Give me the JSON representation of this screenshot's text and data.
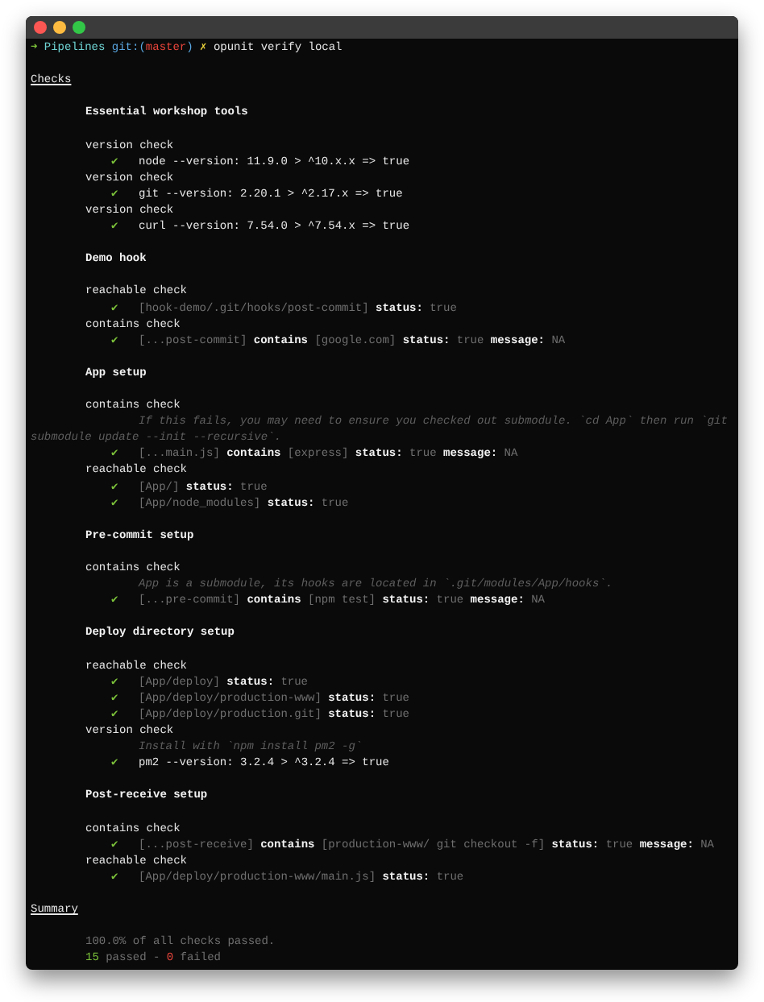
{
  "window": {
    "controls": [
      {
        "color": "#fc5753"
      },
      {
        "color": "#fdbc40"
      },
      {
        "color": "#33c748"
      }
    ]
  },
  "prompt": {
    "arrow": "➜",
    "directory": "Pipelines",
    "branch_open": "git:(",
    "branch": "master",
    "branch_close": ")",
    "dirty_mark": "✗",
    "command": "opunit verify local"
  },
  "checks_heading": "Checks",
  "sections": [
    {
      "title": "Essential workshop tools",
      "checks": [
        {
          "label": "version check",
          "items": [
            {
              "kind": "result",
              "passed": true,
              "mark": "✔",
              "segments": [
                {
                  "text": "node --version: 11.9.0 > ^10.x.x => true",
                  "kind": "plain"
                }
              ]
            }
          ]
        },
        {
          "label": "version check",
          "items": [
            {
              "kind": "result",
              "passed": true,
              "mark": "✔",
              "segments": [
                {
                  "text": "git --version: 2.20.1 > ^2.17.x => true",
                  "kind": "plain"
                }
              ]
            }
          ]
        },
        {
          "label": "version check",
          "items": [
            {
              "kind": "result",
              "passed": true,
              "mark": "✔",
              "segments": [
                {
                  "text": "curl --version: 7.54.0 > ^7.54.x => true",
                  "kind": "plain"
                }
              ]
            }
          ]
        }
      ]
    },
    {
      "title": "Demo hook",
      "checks": [
        {
          "label": "reachable check",
          "items": [
            {
              "kind": "result",
              "passed": true,
              "mark": "✔",
              "segments": [
                {
                  "text": "[hook-demo/.git/hooks/post-commit]",
                  "kind": "dim"
                },
                {
                  "text": "status:",
                  "kind": "bold"
                },
                {
                  "text": "true",
                  "kind": "dim"
                }
              ]
            }
          ]
        },
        {
          "label": "contains check",
          "items": [
            {
              "kind": "result",
              "passed": true,
              "mark": "✔",
              "segments": [
                {
                  "text": "[...post-commit]",
                  "kind": "dim"
                },
                {
                  "text": "contains",
                  "kind": "bold"
                },
                {
                  "text": "[google.com]",
                  "kind": "dim"
                },
                {
                  "text": "status:",
                  "kind": "bold"
                },
                {
                  "text": "true",
                  "kind": "dim"
                },
                {
                  "text": "message:",
                  "kind": "bold"
                },
                {
                  "text": "NA",
                  "kind": "dim"
                }
              ]
            }
          ]
        }
      ]
    },
    {
      "title": "App setup",
      "checks": [
        {
          "label": "contains check",
          "items": [
            {
              "kind": "note",
              "lines": [
                "If this fails, you may need to ensure you checked out submodule. `cd App` then run `git",
                "submodule update --init --recursive`."
              ]
            },
            {
              "kind": "result",
              "passed": true,
              "mark": "✔",
              "segments": [
                {
                  "text": "[...main.js]",
                  "kind": "dim"
                },
                {
                  "text": "contains",
                  "kind": "bold"
                },
                {
                  "text": "[express]",
                  "kind": "dim"
                },
                {
                  "text": "status:",
                  "kind": "bold"
                },
                {
                  "text": "true",
                  "kind": "dim"
                },
                {
                  "text": "message:",
                  "kind": "bold"
                },
                {
                  "text": "NA",
                  "kind": "dim"
                }
              ]
            }
          ]
        },
        {
          "label": "reachable check",
          "items": [
            {
              "kind": "result",
              "passed": true,
              "mark": "✔",
              "segments": [
                {
                  "text": "[App/]",
                  "kind": "dim"
                },
                {
                  "text": "status:",
                  "kind": "bold"
                },
                {
                  "text": "true",
                  "kind": "dim"
                }
              ]
            },
            {
              "kind": "result",
              "passed": true,
              "mark": "✔",
              "segments": [
                {
                  "text": "[App/node_modules]",
                  "kind": "dim"
                },
                {
                  "text": "status:",
                  "kind": "bold"
                },
                {
                  "text": "true",
                  "kind": "dim"
                }
              ]
            }
          ]
        }
      ]
    },
    {
      "title": "Pre-commit setup",
      "checks": [
        {
          "label": "contains check",
          "items": [
            {
              "kind": "note",
              "lines": [
                "App is a submodule, its hooks are located in `.git/modules/App/hooks`."
              ]
            },
            {
              "kind": "result",
              "passed": true,
              "mark": "✔",
              "segments": [
                {
                  "text": "[...pre-commit]",
                  "kind": "dim"
                },
                {
                  "text": "contains",
                  "kind": "bold"
                },
                {
                  "text": "[npm test]",
                  "kind": "dim"
                },
                {
                  "text": "status:",
                  "kind": "bold"
                },
                {
                  "text": "true",
                  "kind": "dim"
                },
                {
                  "text": "message:",
                  "kind": "bold"
                },
                {
                  "text": "NA",
                  "kind": "dim"
                }
              ]
            }
          ]
        }
      ]
    },
    {
      "title": "Deploy directory setup",
      "checks": [
        {
          "label": "reachable check",
          "items": [
            {
              "kind": "result",
              "passed": true,
              "mark": "✔",
              "segments": [
                {
                  "text": "[App/deploy]",
                  "kind": "dim"
                },
                {
                  "text": "status:",
                  "kind": "bold"
                },
                {
                  "text": "true",
                  "kind": "dim"
                }
              ]
            },
            {
              "kind": "result",
              "passed": true,
              "mark": "✔",
              "segments": [
                {
                  "text": "[App/deploy/production-www]",
                  "kind": "dim"
                },
                {
                  "text": "status:",
                  "kind": "bold"
                },
                {
                  "text": "true",
                  "kind": "dim"
                }
              ]
            },
            {
              "kind": "result",
              "passed": true,
              "mark": "✔",
              "segments": [
                {
                  "text": "[App/deploy/production.git]",
                  "kind": "dim"
                },
                {
                  "text": "status:",
                  "kind": "bold"
                },
                {
                  "text": "true",
                  "kind": "dim"
                }
              ]
            }
          ]
        },
        {
          "label": "version check",
          "items": [
            {
              "kind": "note",
              "lines": [
                "Install with `npm install pm2 -g`"
              ]
            },
            {
              "kind": "result",
              "passed": true,
              "mark": "✔",
              "segments": [
                {
                  "text": "pm2 --version: 3.2.4 > ^3.2.4 => true",
                  "kind": "plain"
                }
              ]
            }
          ]
        }
      ]
    },
    {
      "title": "Post-receive setup",
      "checks": [
        {
          "label": "contains check",
          "items": [
            {
              "kind": "result",
              "passed": true,
              "mark": "✔",
              "segments": [
                {
                  "text": "[...post-receive]",
                  "kind": "dim"
                },
                {
                  "text": "contains",
                  "kind": "bold"
                },
                {
                  "text": "[production-www/ git checkout -f]",
                  "kind": "dim"
                },
                {
                  "text": "status:",
                  "kind": "bold"
                },
                {
                  "text": "true",
                  "kind": "dim"
                },
                {
                  "text": "message:",
                  "kind": "bold"
                },
                {
                  "text": "NA",
                  "kind": "dim"
                }
              ]
            }
          ]
        },
        {
          "label": "reachable check",
          "items": [
            {
              "kind": "result",
              "passed": true,
              "mark": "✔",
              "segments": [
                {
                  "text": "[App/deploy/production-www/main.js]",
                  "kind": "dim"
                },
                {
                  "text": "status:",
                  "kind": "bold"
                },
                {
                  "text": "true",
                  "kind": "dim"
                }
              ]
            }
          ]
        }
      ]
    }
  ],
  "summary_heading": "Summary",
  "summary": {
    "percent_line": "100.0% of all checks passed.",
    "passed_count": "15",
    "passed_label": "passed -",
    "failed_count": "0",
    "failed_label": "failed"
  }
}
